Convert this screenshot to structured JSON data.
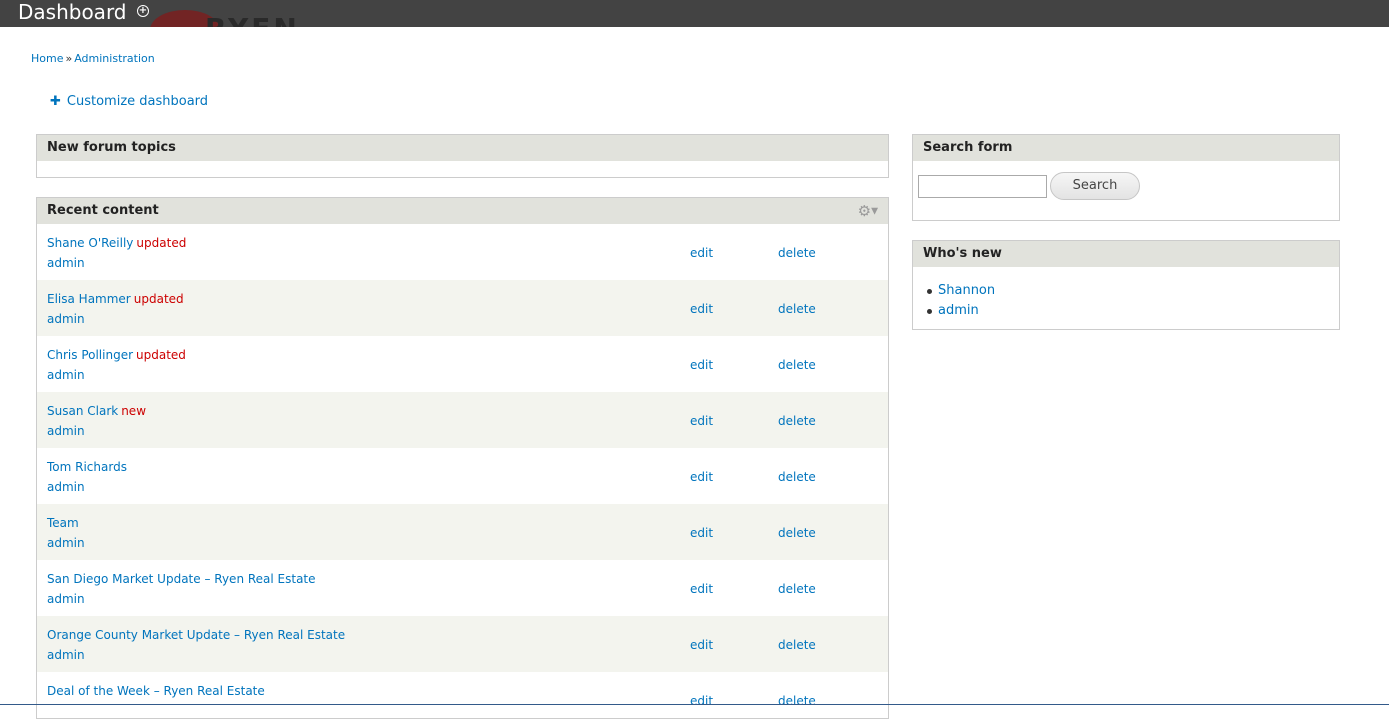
{
  "titlebar": {
    "title": "Dashboard",
    "logo_text": "RYEN"
  },
  "breadcrumb": {
    "items": [
      "Home",
      "Administration"
    ],
    "separator": "»"
  },
  "customize": {
    "label": "Customize dashboard"
  },
  "blocks": {
    "forum": {
      "title": "New forum topics"
    },
    "recent": {
      "title": "Recent content",
      "rows": [
        {
          "title": "Shane O'Reilly",
          "marker": "updated",
          "author": "admin",
          "edit": "edit",
          "delete": "delete"
        },
        {
          "title": "Elisa Hammer",
          "marker": "updated",
          "author": "admin",
          "edit": "edit",
          "delete": "delete"
        },
        {
          "title": "Chris Pollinger",
          "marker": "updated",
          "author": "admin",
          "edit": "edit",
          "delete": "delete"
        },
        {
          "title": "Susan Clark",
          "marker": "new",
          "author": "admin",
          "edit": "edit",
          "delete": "delete"
        },
        {
          "title": "Tom Richards",
          "marker": "",
          "author": "admin",
          "edit": "edit",
          "delete": "delete"
        },
        {
          "title": "Team",
          "marker": "",
          "author": "admin",
          "edit": "edit",
          "delete": "delete"
        },
        {
          "title": "San Diego Market Update – Ryen Real Estate",
          "marker": "",
          "author": "admin",
          "edit": "edit",
          "delete": "delete"
        },
        {
          "title": "Orange County Market Update – Ryen Real Estate",
          "marker": "",
          "author": "admin",
          "edit": "edit",
          "delete": "delete"
        },
        {
          "title": "Deal of the Week – Ryen Real Estate",
          "marker": "",
          "author": "",
          "edit": "edit",
          "delete": "delete"
        }
      ]
    },
    "search": {
      "title": "Search form",
      "input_value": "",
      "button_label": "Search"
    },
    "whosnew": {
      "title": "Who's new",
      "users": [
        "Shannon",
        "admin"
      ]
    }
  },
  "colors": {
    "titlebar_bg": "#434343",
    "link": "#0074bd",
    "marker": "#cc0000",
    "block_header_bg": "#e1e2dc",
    "row_alt_bg": "#f3f4ee"
  }
}
